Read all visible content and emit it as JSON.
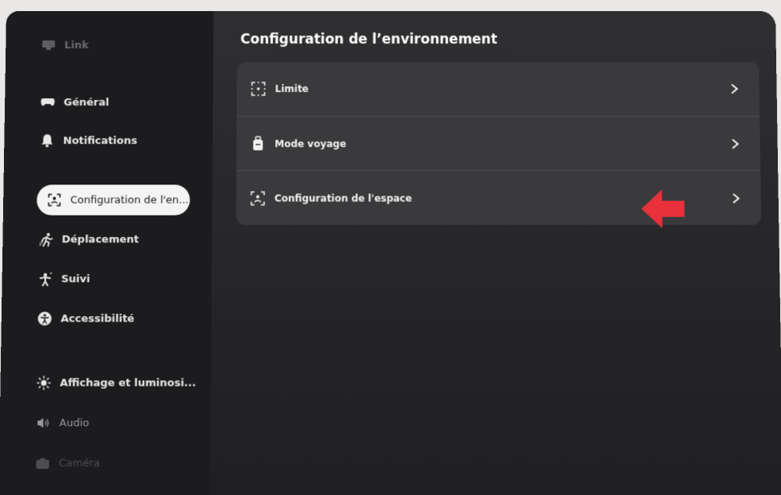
{
  "sidebar": {
    "items": [
      {
        "label": "Link",
        "icon": "headset-link-icon"
      },
      {
        "label": "Général",
        "icon": "gamepad-icon"
      },
      {
        "label": "Notifications",
        "icon": "bell-icon"
      },
      {
        "label": "Configuration de l'en...",
        "icon": "space-setup-icon"
      },
      {
        "label": "Déplacement",
        "icon": "walking-icon"
      },
      {
        "label": "Suivi",
        "icon": "tracking-icon"
      },
      {
        "label": "Accessibilité",
        "icon": "accessibility-icon"
      },
      {
        "label": "Affichage et luminosi...",
        "icon": "sun-icon"
      },
      {
        "label": "Audio",
        "icon": "speaker-icon"
      },
      {
        "label": "Caméra",
        "icon": "camera-icon"
      }
    ],
    "active_index": 3
  },
  "main": {
    "title": "Configuration de l’environnement",
    "rows": [
      {
        "label": "Limite",
        "icon": "boundary-icon"
      },
      {
        "label": "Mode voyage",
        "icon": "luggage-icon"
      },
      {
        "label": "Configuration de l'espace",
        "icon": "space-setup-icon"
      }
    ]
  },
  "annotation": {
    "arrow_color": "#e8313b",
    "points_to": "Configuration de l'espace"
  },
  "colors": {
    "sidebar_bg": "#1c1c1e",
    "main_bg": "#2c2c2e",
    "card_bg": "#3a3a3c",
    "active_pill": "#f4f4f4"
  }
}
